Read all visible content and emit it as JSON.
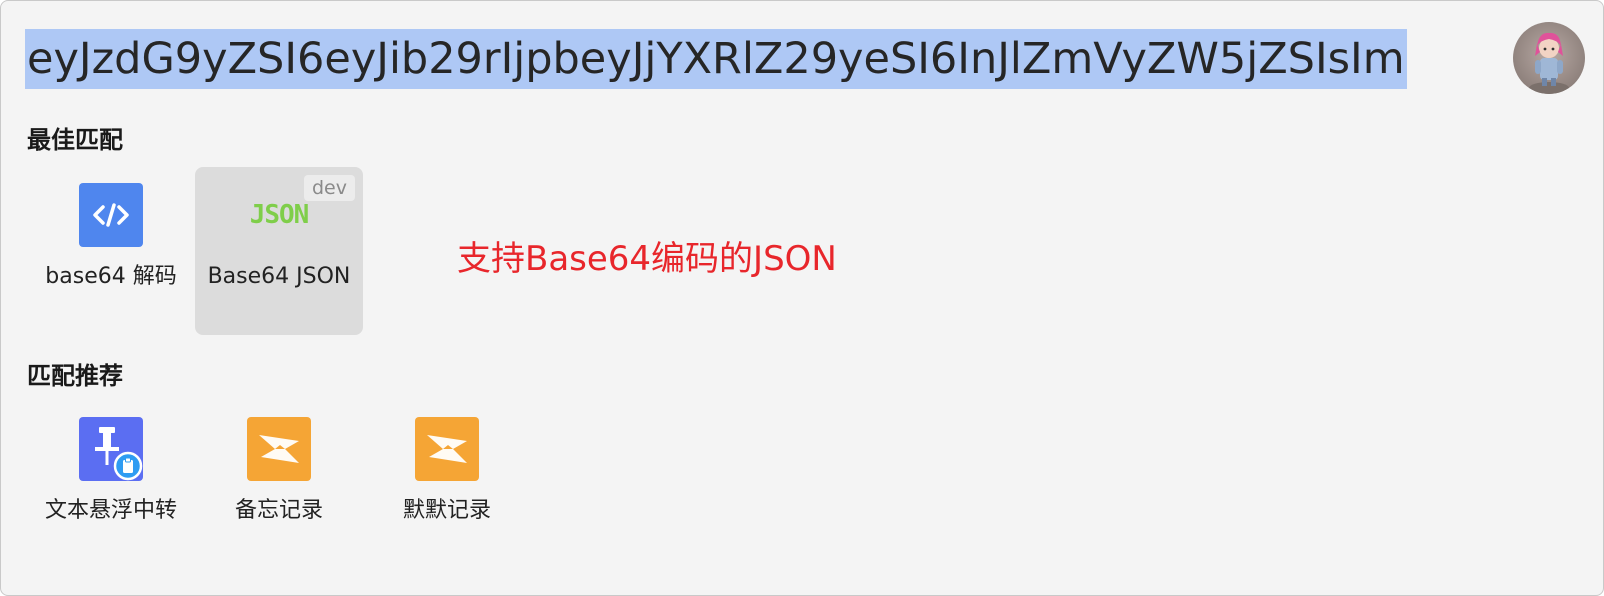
{
  "search": {
    "value": "eyJzdG9yZSI6eyJib29rIjpbeyJjYXRlZ29yeSI6InJlZmVyZW5jZSIsIm"
  },
  "sections": {
    "best_match_title": "最佳匹配",
    "recommend_title": "匹配推荐"
  },
  "best_match": [
    {
      "label": "base64 解码",
      "icon": "code-brackets-icon",
      "color": "#4f86ee"
    },
    {
      "label": "Base64 JSON",
      "icon": "json-icon",
      "badge": "dev",
      "icon_text": "JSON",
      "color": "#7fce4a",
      "selected": true
    }
  ],
  "recommend": [
    {
      "label": "文本悬浮中转",
      "icon": "pin-clipboard-icon",
      "color": "#5b6ef2"
    },
    {
      "label": "备忘记录",
      "icon": "sparkle-note-icon",
      "color": "#f5a535"
    },
    {
      "label": "默默记录",
      "icon": "sparkle-note-icon",
      "color": "#f5a535"
    }
  ],
  "annotation": "支持Base64编码的JSON"
}
